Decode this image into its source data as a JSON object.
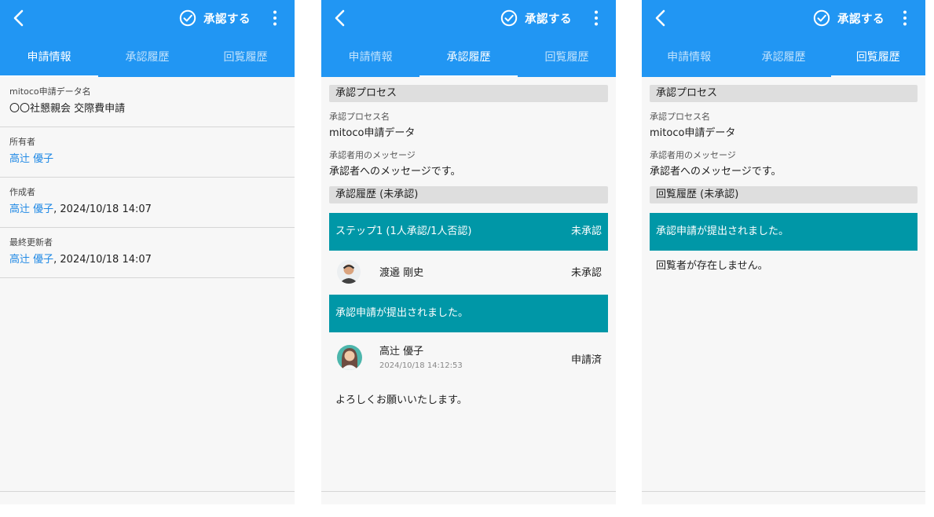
{
  "appbar": {
    "approve_label": "承認する"
  },
  "tabs": [
    "申請情報",
    "承認履歴",
    "回覧履歴"
  ],
  "detail": {
    "fields": [
      {
        "label": "mitoco申請データ名",
        "value": "〇〇社懇親会 交際費申請",
        "link": "",
        "suffix": ""
      },
      {
        "label": "所有者",
        "value": "",
        "link": "高辻 優子",
        "suffix": ""
      },
      {
        "label": "作成者",
        "value": "",
        "link": "高辻 優子",
        "suffix": ", 2024/10/18 14:07"
      },
      {
        "label": "最終更新者",
        "value": "",
        "link": "高辻 優子",
        "suffix": ", 2024/10/18 14:07"
      }
    ]
  },
  "approval": {
    "process_header": "承認プロセス",
    "process_name_label": "承認プロセス名",
    "process_name": "mitoco申請データ",
    "message_label": "承認者用のメッセージ",
    "message": "承認者へのメッセージです。",
    "history_header": "承認履歴 (未承認)",
    "step_title": "ステップ1 (1人承認/1人否認)",
    "step_status": "未承認",
    "approver_name": "渡邉 剛史",
    "approver_status": "未承認",
    "submitted_title": "承認申請が提出されました。",
    "applicant_name": "高辻 優子",
    "applicant_date": "2024/10/18 14:12:53",
    "applicant_status": "申請済",
    "comment": "よろしくお願いいたします。"
  },
  "circulation": {
    "process_header": "承認プロセス",
    "process_name_label": "承認プロセス名",
    "process_name": "mitoco申請データ",
    "message_label": "承認者用のメッセージ",
    "message": "承認者へのメッセージです。",
    "history_header": "回覧履歴 (未承認)",
    "submitted_title": "承認申請が提出されました。",
    "note": "回覧者が存在しません。"
  },
  "colors": {
    "appbar": "#2196f3",
    "teal": "#0097a7",
    "link": "#1e88e5",
    "section": "#dedede"
  },
  "icons": [
    "back-arrow-icon",
    "check-circle-icon",
    "more-vert-icon"
  ]
}
